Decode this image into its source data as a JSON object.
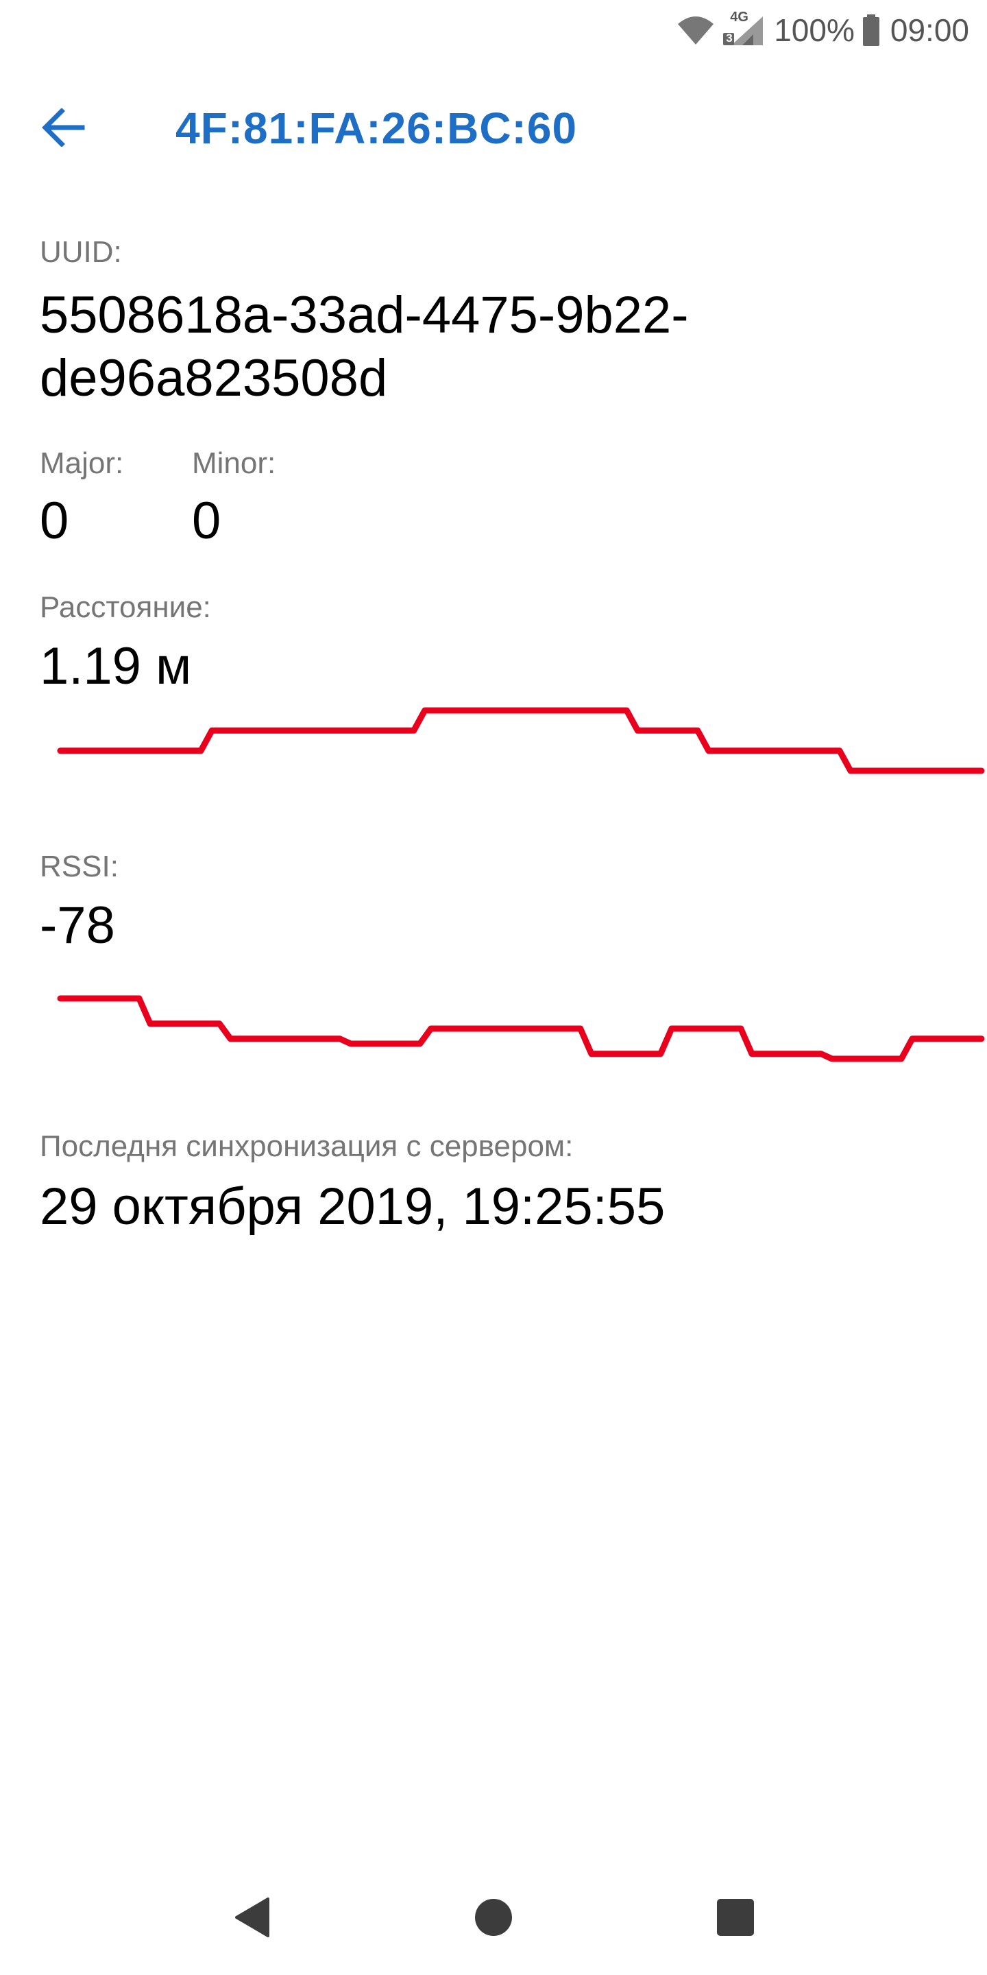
{
  "status_bar": {
    "network": "4G",
    "sim_slot": "3",
    "battery": "100%",
    "time": "09:00"
  },
  "app_bar": {
    "title": "4F:81:FA:26:BC:60",
    "back_icon": "arrow-left-icon"
  },
  "details": {
    "uuid_label": "UUID:",
    "uuid_value": "5508618a-33ad-4475-9b22-de96a823508d",
    "major_label": "Major:",
    "major_value": "0",
    "minor_label": "Minor:",
    "minor_value": "0",
    "distance_label": "Расстояние:",
    "distance_value": "1.19 м",
    "rssi_label": "RSSI:",
    "rssi_value": "-78",
    "sync_label": "Последня синхронизация с сервером:",
    "sync_value": "29 октября 2019, 19:25:55"
  },
  "charts": {
    "line_color": "#e8001c",
    "distance_series": [
      1.19,
      1.19,
      1.2,
      1.2,
      1.2,
      1.21,
      1.21,
      1.21,
      1.2,
      1.19,
      1.19,
      1.18,
      1.18
    ],
    "rssi_series": [
      -70,
      -70,
      -75,
      -75,
      -78,
      -78,
      -78,
      -79,
      -79,
      -76,
      -76,
      -76,
      -76,
      -81,
      -81,
      -76,
      -76,
      -81,
      -81,
      -82,
      -82,
      -78,
      -78
    ]
  },
  "nav_bar": {
    "back_icon": "triangle-back-icon",
    "home_icon": "circle-home-icon",
    "recents_icon": "square-recents-icon"
  },
  "colors": {
    "accent": "#1e6ec6",
    "label": "#757575",
    "value": "#000000",
    "chart_line": "#e8001c"
  }
}
